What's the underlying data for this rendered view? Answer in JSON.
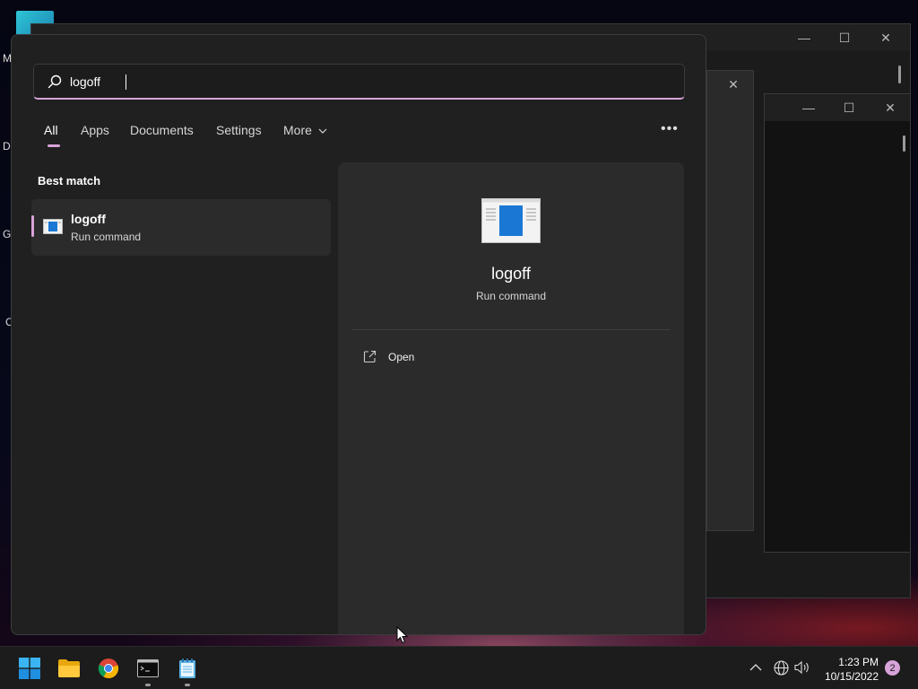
{
  "search": {
    "query": "logoff",
    "placeholder": ""
  },
  "tabs": [
    {
      "label": "All",
      "active": true
    },
    {
      "label": "Apps"
    },
    {
      "label": "Documents"
    },
    {
      "label": "Settings"
    },
    {
      "label": "More"
    }
  ],
  "best_match": {
    "section_title": "Best match",
    "title": "logoff",
    "subtitle": "Run command"
  },
  "detail": {
    "title": "logoff",
    "subtitle": "Run command",
    "actions": [
      {
        "label": "Open",
        "icon": "open-external-icon"
      }
    ]
  },
  "taskbar": {
    "apps": [
      {
        "name": "start",
        "icon": "windows-logo-icon"
      },
      {
        "name": "file-explorer",
        "icon": "folder-icon"
      },
      {
        "name": "chrome",
        "icon": "chrome-icon"
      },
      {
        "name": "terminal",
        "icon": "terminal-icon",
        "running": true
      },
      {
        "name": "notepad",
        "icon": "notepad-icon",
        "running": true
      }
    ],
    "time": "1:23 PM",
    "date": "10/15/2022",
    "notification_count": "2"
  },
  "desktop": {
    "icon_letters": [
      "M",
      "Da",
      "Gi",
      "C"
    ]
  },
  "colors": {
    "accent": "#d8a3d8",
    "flyout_bg": "#202020",
    "pane_bg": "#2b2b2b"
  }
}
